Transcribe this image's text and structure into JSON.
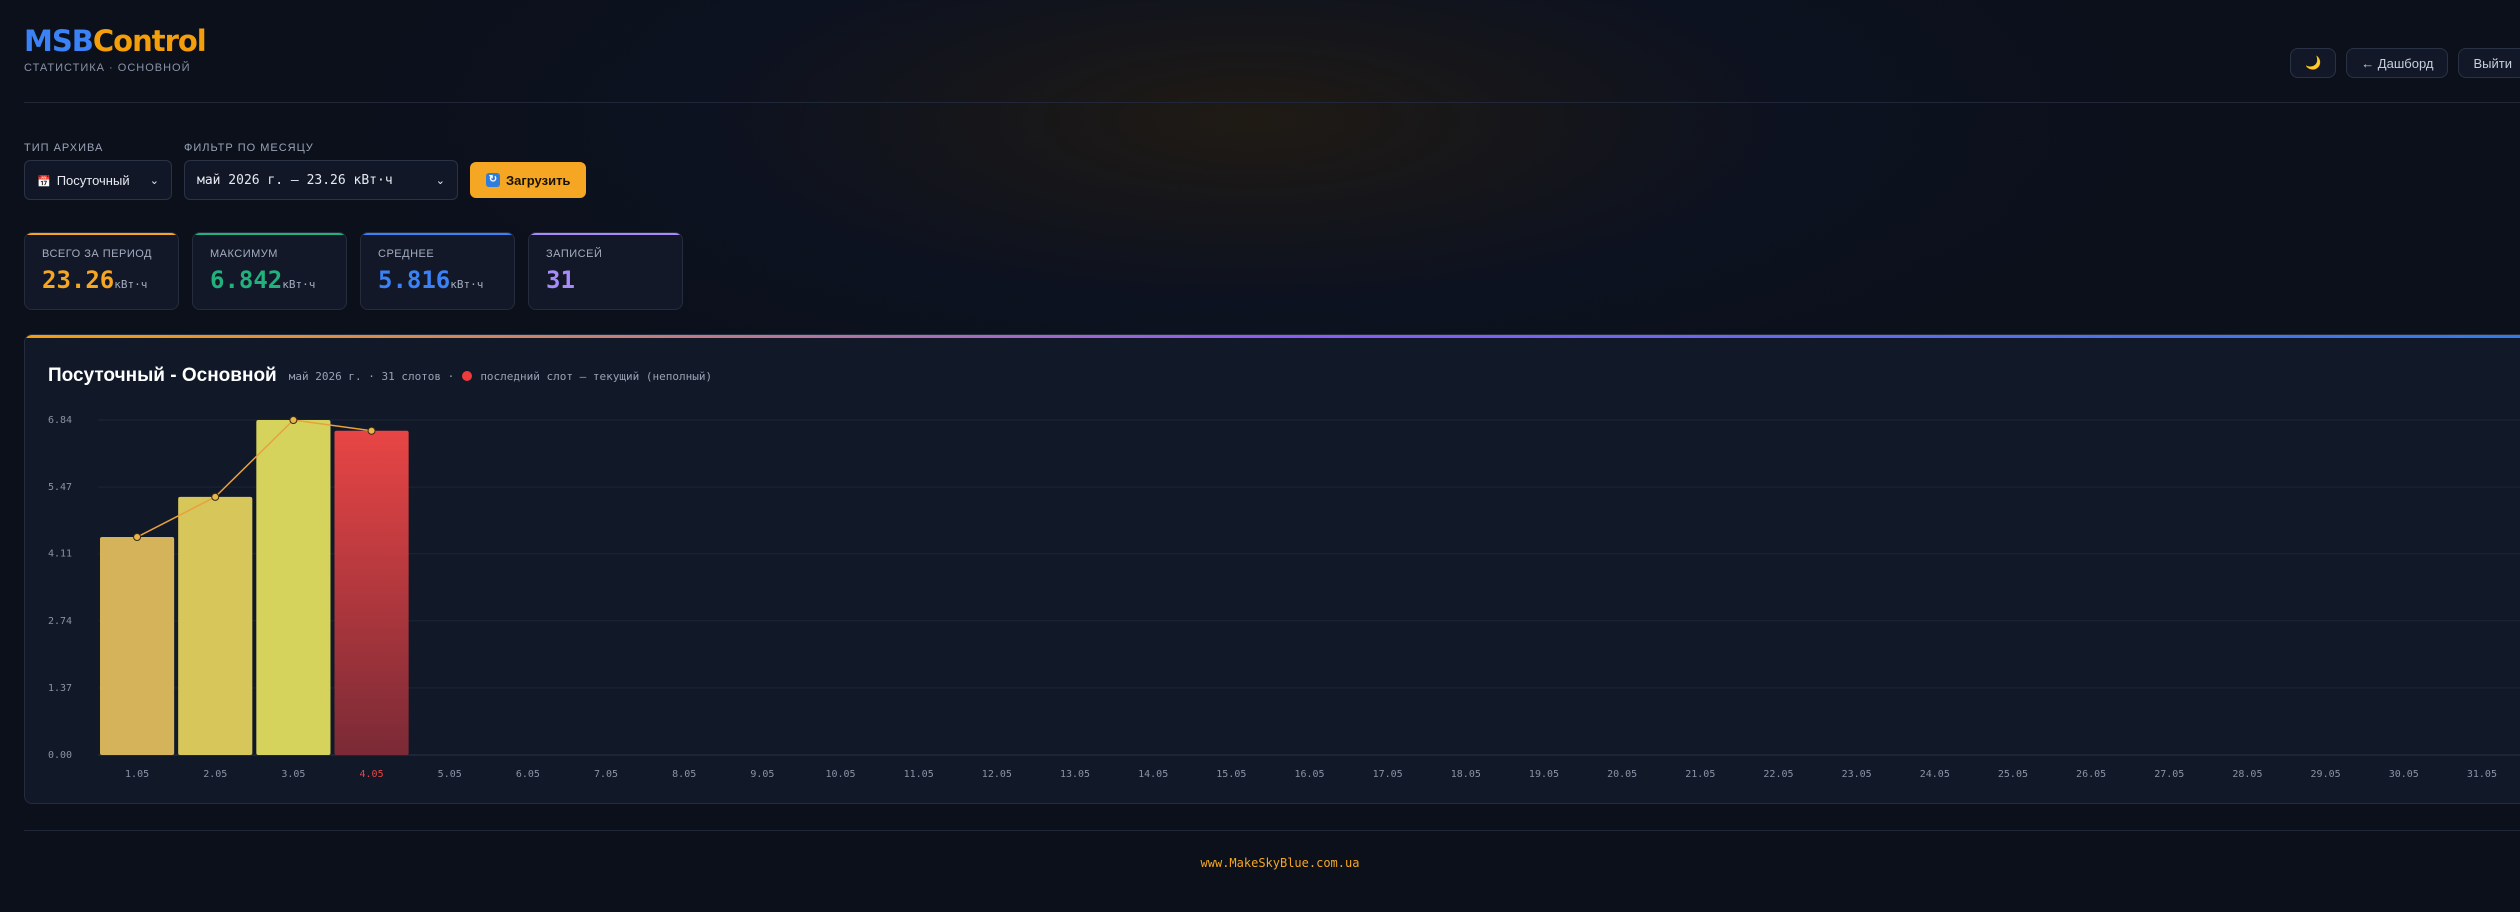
{
  "header": {
    "logo_part1": "MSB",
    "logo_part2": "Control",
    "subtitle": "СТАТИСТИКА · ОСНОВНОЙ",
    "theme_icon": "🌙",
    "dashboard_label": "← Дашборд",
    "logout_label": "Выйти"
  },
  "controls": {
    "archive_type_label": "ТИП АРХИВА",
    "archive_type_icon": "📅",
    "archive_type_value": "Посуточный",
    "month_filter_label": "ФИЛЬТР ПО МЕСЯЦУ",
    "month_filter_value": "май 2026 г. — 23.26 кВт·ч",
    "load_icon": "↻",
    "load_label": "Загрузить"
  },
  "stats": [
    {
      "label": "ВСЕГО ЗА ПЕРИОД",
      "value": "23.26",
      "unit": "кВт·ч",
      "color": "#f5a623"
    },
    {
      "label": "МАКСИМУМ",
      "value": "6.842",
      "unit": "кВт·ч",
      "color": "#22b07d"
    },
    {
      "label": "СРЕДНЕЕ",
      "value": "5.816",
      "unit": "кВт·ч",
      "color": "#3b82f6"
    },
    {
      "label": "ЗАПИСЕЙ",
      "value": "31",
      "unit": "",
      "color": "#a78bfa"
    }
  ],
  "chart": {
    "title": "Посуточный - Основной",
    "meta": "май 2026 г. · 31 слотов ·",
    "legend_note": "последний слот — текущий (неполный)"
  },
  "chart_data": {
    "type": "bar",
    "categories": [
      "1.05",
      "2.05",
      "3.05",
      "4.05",
      "5.05",
      "6.05",
      "7.05",
      "8.05",
      "9.05",
      "10.05",
      "11.05",
      "12.05",
      "13.05",
      "14.05",
      "15.05",
      "16.05",
      "17.05",
      "18.05",
      "19.05",
      "20.05",
      "21.05",
      "22.05",
      "23.05",
      "24.05",
      "25.05",
      "26.05",
      "27.05",
      "28.05",
      "29.05",
      "30.05",
      "31.05"
    ],
    "values": [
      4.45,
      5.27,
      6.84,
      6.62
    ],
    "current_index": 3,
    "yticks": [
      "0.00",
      "1.37",
      "2.74",
      "4.11",
      "5.47",
      "6.84"
    ],
    "ylim": [
      0,
      6.84
    ],
    "grid": true,
    "colors": {
      "bar1": "#d4b35a",
      "bar2": "#d7c65a",
      "bar3": "#d6d35d",
      "current": "#e84545",
      "line": "#e8a13c"
    }
  },
  "footer": {
    "link": "www.MakeSkyBlue.com.ua"
  }
}
